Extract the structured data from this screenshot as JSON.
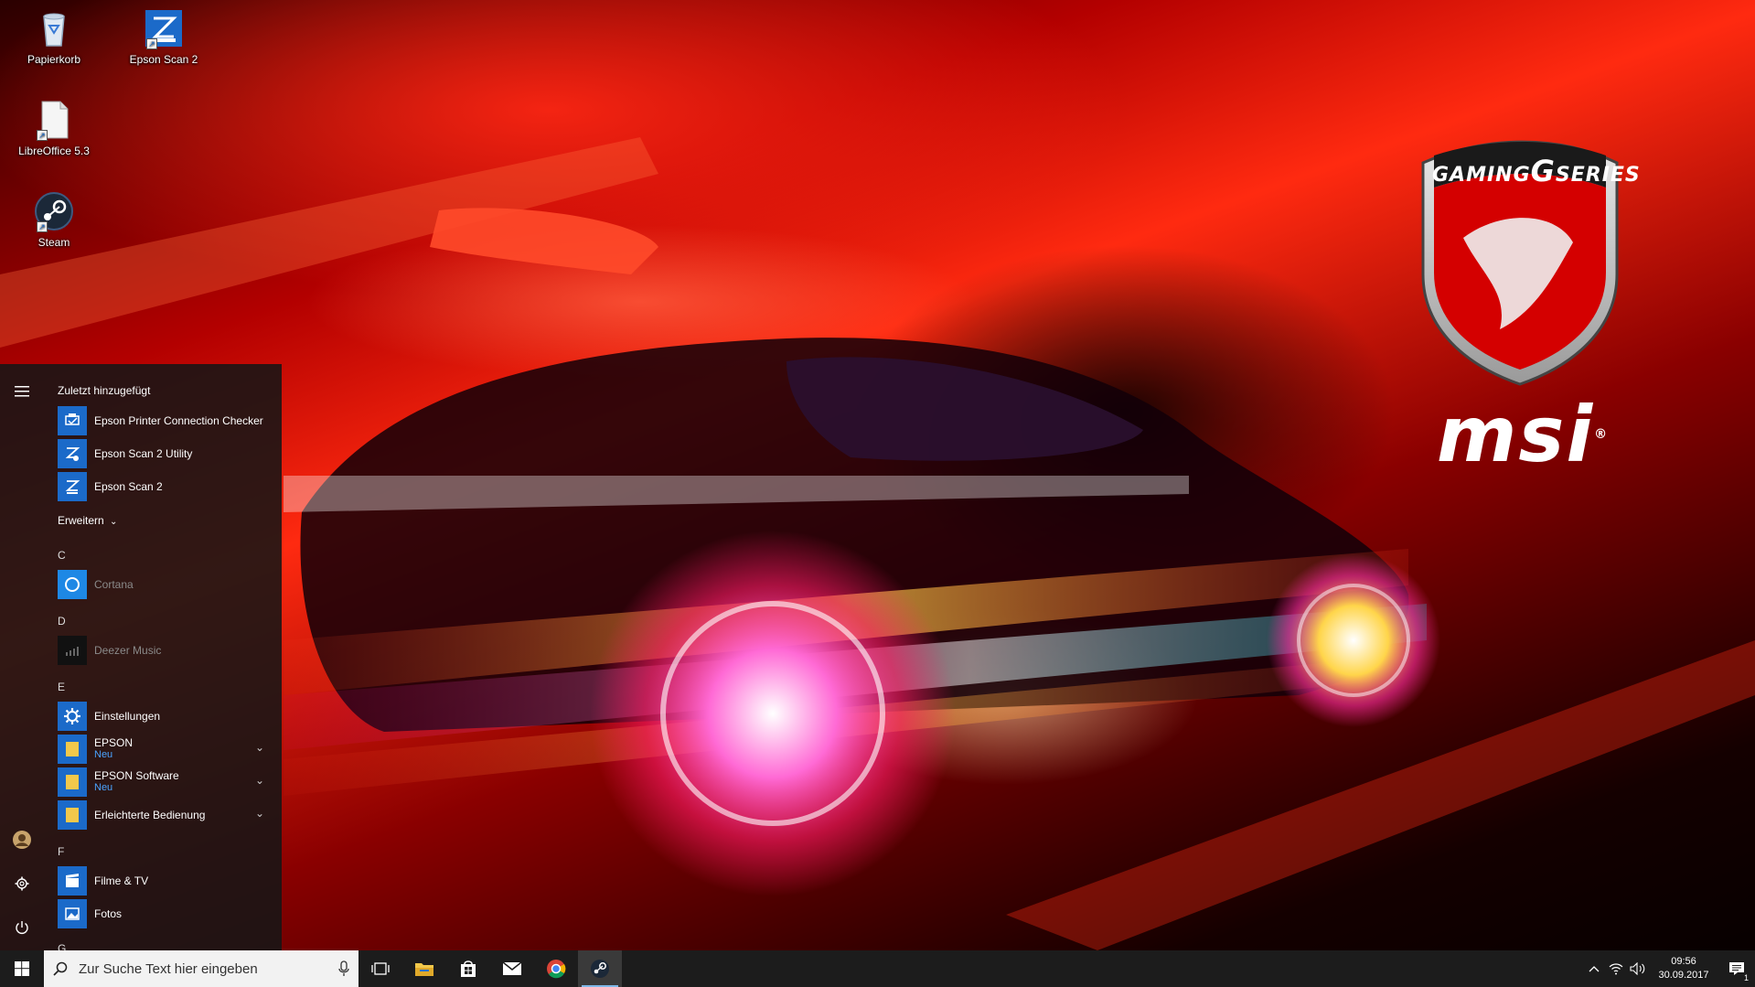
{
  "desktop": {
    "icons": [
      {
        "label": "Papierkorb",
        "icon": "recycle-bin-icon"
      },
      {
        "label": "Epson Scan 2",
        "icon": "epson-scan-icon"
      },
      {
        "label": "LibreOffice 5.3",
        "icon": "libreoffice-file-icon"
      },
      {
        "label": "Steam",
        "icon": "steam-icon"
      }
    ],
    "wallpaper": {
      "logo_top": "GAMING",
      "logo_g": "G",
      "logo_series": "SERIES",
      "brand": "msi",
      "registered": "®"
    }
  },
  "start_menu": {
    "recently_added_heading": "Zuletzt hinzugefügt",
    "recent_apps": [
      {
        "label": "Epson Printer Connection Checker",
        "icon": "printer-checker-icon"
      },
      {
        "label": "Epson Scan 2 Utility",
        "icon": "scan-utility-icon"
      },
      {
        "label": "Epson Scan 2",
        "icon": "epson-scan-icon"
      }
    ],
    "expand_label": "Erweitern",
    "groups": [
      {
        "letter": "C",
        "apps": [
          {
            "label": "Cortana",
            "icon": "cortana-icon",
            "dim": true
          }
        ]
      },
      {
        "letter": "D",
        "apps": [
          {
            "label": "Deezer Music",
            "icon": "deezer-icon",
            "dim": true
          }
        ]
      },
      {
        "letter": "E",
        "apps": [
          {
            "label": "Einstellungen",
            "icon": "gear-icon"
          },
          {
            "label": "EPSON",
            "sub": "Neu",
            "icon": "folder-icon",
            "expandable": true
          },
          {
            "label": "EPSON Software",
            "sub": "Neu",
            "icon": "folder-icon",
            "expandable": true
          },
          {
            "label": "Erleichterte Bedienung",
            "icon": "folder-icon",
            "expandable": true
          }
        ]
      },
      {
        "letter": "F",
        "apps": [
          {
            "label": "Filme & TV",
            "icon": "film-icon"
          },
          {
            "label": "Fotos",
            "icon": "photos-icon"
          }
        ]
      },
      {
        "letter": "G",
        "apps": []
      }
    ],
    "rail": [
      "hamburger-menu-icon",
      "user-avatar-icon",
      "settings-gear-icon",
      "power-icon"
    ]
  },
  "taskbar": {
    "search_placeholder": "Zur Suche Text hier eingeben",
    "pinned": [
      "task-view-icon",
      "file-explorer-icon",
      "store-icon",
      "mail-icon",
      "chrome-icon",
      "steam-icon"
    ],
    "active_app": "steam-icon",
    "time": "09:56",
    "date": "30.09.2017",
    "notification_count": "1"
  },
  "colors": {
    "accent": "#1e88e5",
    "tile_blue": "#1b6ac9",
    "folder_yellow": "#f2c84b",
    "new_label": "#4aa3ff",
    "taskbar": "#1c1c1c"
  }
}
